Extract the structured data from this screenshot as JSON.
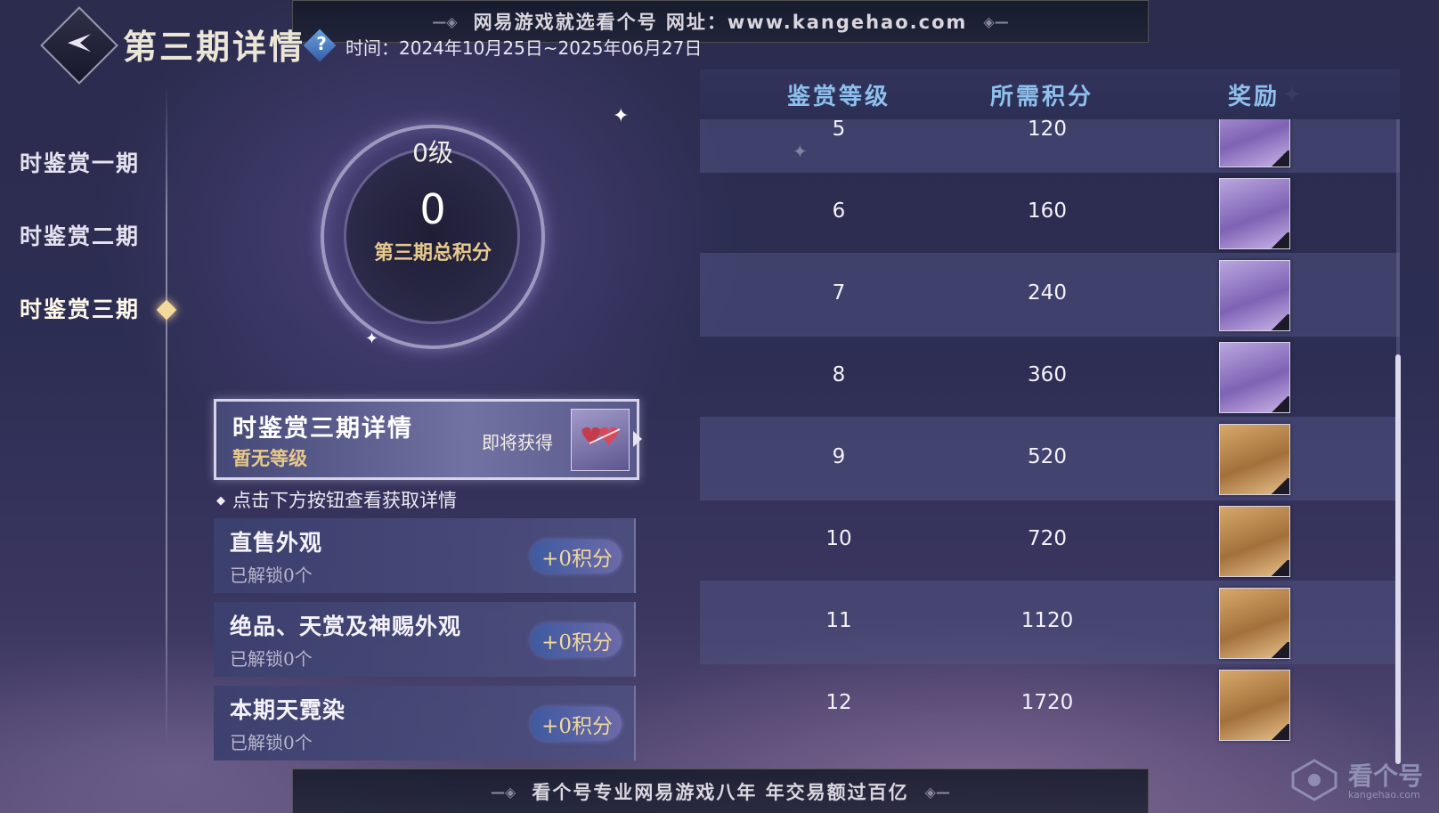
{
  "watermark": {
    "top": "网易游戏就选看个号  网址：www.kangehao.com",
    "bottom": "看个号专业网易游戏八年  年交易额过百亿",
    "corner_logo": "看个号",
    "corner_url": "kangehao.com"
  },
  "header": {
    "title": "第三期详情",
    "help_symbol": "?",
    "time": "时间：2024年10月25日~2025年06月27日"
  },
  "sidebar": {
    "items": [
      {
        "label": "时鉴赏一期",
        "active": false
      },
      {
        "label": "时鉴赏二期",
        "active": false
      },
      {
        "label": "时鉴赏三期",
        "active": true
      }
    ]
  },
  "dial": {
    "level": "0级",
    "score": "0",
    "caption": "第三期总积分"
  },
  "detail_card": {
    "title": "时鉴赏三期详情",
    "level": "暂无等级",
    "soon": "即将获得"
  },
  "hint": "点击下方按钮查看获取详情",
  "categories": [
    {
      "name": "直售外观",
      "unlocked": "已解锁0个",
      "points": "+0积分"
    },
    {
      "name": "绝品、天赏及神赐外观",
      "unlocked": "已解锁0个",
      "points": "+0积分"
    },
    {
      "name": "本期天霓染",
      "unlocked": "已解锁0个",
      "points": "+0积分"
    }
  ],
  "table": {
    "headers": [
      "鉴赏等级",
      "所需积分",
      "奖励"
    ],
    "rows": [
      {
        "level": "5",
        "points": "120",
        "tier": "purple"
      },
      {
        "level": "6",
        "points": "160",
        "tier": "purple"
      },
      {
        "level": "7",
        "points": "240",
        "tier": "purple"
      },
      {
        "level": "8",
        "points": "360",
        "tier": "purple"
      },
      {
        "level": "9",
        "points": "520",
        "tier": "gold"
      },
      {
        "level": "10",
        "points": "720",
        "tier": "gold"
      },
      {
        "level": "11",
        "points": "1120",
        "tier": "gold"
      },
      {
        "level": "12",
        "points": "1720",
        "tier": "gold"
      }
    ],
    "scroll_fraction": 0.36
  },
  "colors": {
    "header_text": "#8ec0ee",
    "gold_text": "#e8c98a",
    "background": "#2c2d52"
  }
}
